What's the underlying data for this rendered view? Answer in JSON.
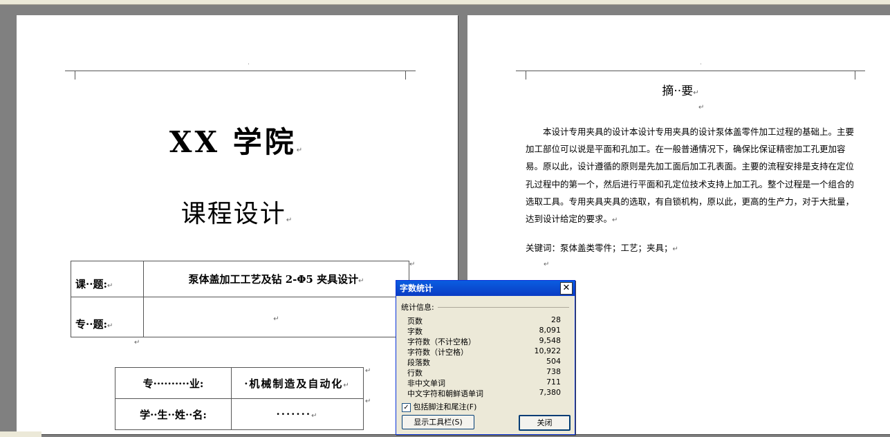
{
  "page1": {
    "header_mark": ".",
    "school_title": "XX 学院",
    "course_title": "课程设计",
    "topic_table": {
      "rows": [
        {
          "label": "课··题:",
          "value": "泵体盖加工工艺及钻 2-Φ5 夹具设计"
        },
        {
          "label": "专··题:",
          "value": ""
        }
      ]
    },
    "student_table": {
      "rows": [
        {
          "label": "专··········业:",
          "value": "·机械制造及自动化"
        },
        {
          "label": "学··生··姓··名:",
          "value": "·······"
        }
      ]
    }
  },
  "page2": {
    "header_mark": ".",
    "abstract_title": "摘··要",
    "abstract_body": "本设计专用夹具的设计本设计专用夹具的设计泵体盖零件加工过程的基础上。主要加工部位可以说是平面和孔加工。在一般普通情况下，确保比保证精密加工孔更加容易。原以此，设计遵循的原则是先加工面后加工孔表面。主要的流程安排是支持在定位孔过程中的第一个，然后进行平面和孔定位技术支持上加工孔。整个过程是一个组合的选取工具。专用夹具夹具的选取，有自锁机构，原以此，更高的生产力，对于大批量，达到设计给定的要求。",
    "keywords": "关键词：泵体盖类零件；工艺；夹具；"
  },
  "paragraph_mark": "↵",
  "word_count_dialog": {
    "title": "字数统计",
    "close_icon": "✕",
    "group_label": "统计信息:",
    "stats": [
      {
        "label": "页数",
        "value": "28"
      },
      {
        "label": "字数",
        "value": "8,091"
      },
      {
        "label": "字符数（不计空格）",
        "value": "9,548"
      },
      {
        "label": "字符数（计空格）",
        "value": "10,922"
      },
      {
        "label": "段落数",
        "value": "504"
      },
      {
        "label": "行数",
        "value": "738"
      },
      {
        "label": "非中文单词",
        "value": "711"
      },
      {
        "label": "中文字符和朝鲜语单词",
        "value": "7,380"
      }
    ],
    "include_footnotes_label": "包括脚注和尾注(F)",
    "include_footnotes_checked": true,
    "show_toolbar_button": "显示工具栏(S)",
    "close_button": "关闭"
  },
  "colors": {
    "titlebar": "#0a5de0",
    "dialog_bg": "#ece9d8",
    "workspace": "#808080"
  }
}
